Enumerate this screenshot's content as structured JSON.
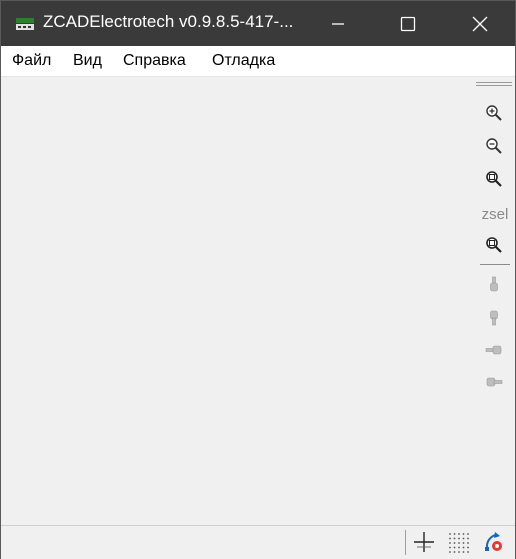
{
  "window": {
    "title": "ZCADElectrotech v0.9.8.5-417-...",
    "colors": {
      "titlebar": "#3a3a3a",
      "client": "#f0f0f0"
    }
  },
  "menu": [
    {
      "label": "Файл"
    },
    {
      "label": "Вид"
    },
    {
      "label": "Справка"
    },
    {
      "label": "Отладка"
    }
  ],
  "toolbar": {
    "tools": [
      {
        "icon": "zoom-in-icon"
      },
      {
        "icon": "zoom-out-icon"
      },
      {
        "icon": "zoom-window-icon"
      },
      {
        "icon": "zoom-selection-icon"
      },
      {
        "icon": "pan-up-icon"
      },
      {
        "icon": "pan-down-icon"
      },
      {
        "icon": "pan-left-icon"
      },
      {
        "icon": "pan-right-icon"
      }
    ],
    "zsel_label": "zsel"
  },
  "statusbar": {
    "icons": [
      "crosshair-snap-icon",
      "grid-icon",
      "osnap-icon"
    ]
  }
}
